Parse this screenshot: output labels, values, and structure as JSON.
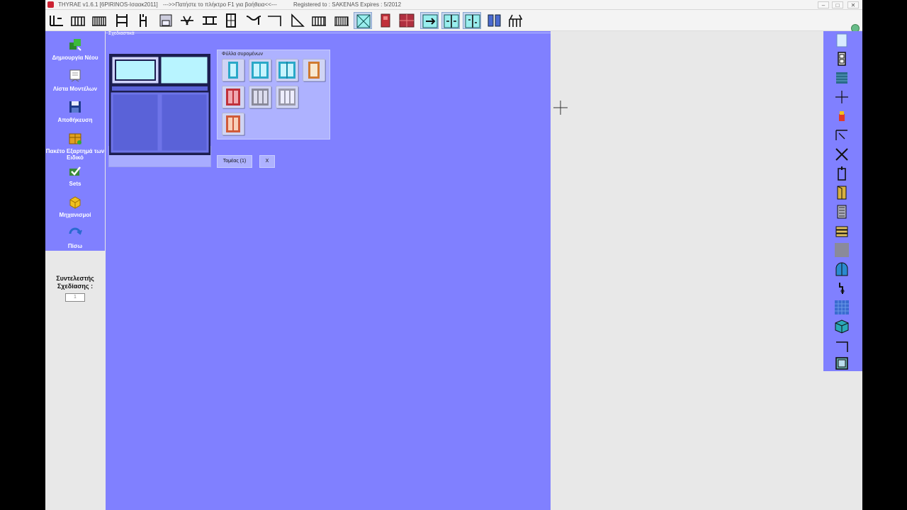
{
  "titlebar": {
    "app": "THYRAE v1.6.1 [6PIRINOS-Ισαακ2011]",
    "help": "--->>Πατήστε το πλήκτρο F1 για βοήθεια<<---",
    "registered": "Registered to : SAKENAS   Expires : 5/2012",
    "minimize": "–",
    "maximize": "□",
    "close": "✕"
  },
  "sidebar": {
    "items": [
      {
        "label": "Δημιουργία Νέου",
        "icon": "new-model-icon"
      },
      {
        "label": "Λίστα Μοντέλων",
        "icon": "model-list-icon"
      },
      {
        "label": "Αποθήκευση",
        "icon": "save-icon"
      },
      {
        "label": "Πακέτο Εξαρτημά των Ειδικό",
        "icon": "parts-package-icon"
      },
      {
        "label": "Sets",
        "icon": "sets-icon"
      },
      {
        "label": "Μηχανισμοί",
        "icon": "mechanisms-icon"
      },
      {
        "label": "Πίσω",
        "icon": "back-icon"
      }
    ],
    "coefficient_label": "Συντελεστής Σχεδίασης :",
    "coefficient_value": "1"
  },
  "canvas": {
    "title": "Σχεδιαστικά"
  },
  "sashes": {
    "title": "Φύλλα συρομένων"
  },
  "buttons": {
    "sections": "Τομέας (1)",
    "close": "X"
  },
  "colors": {
    "panel": "#8080ff",
    "workspace": "#e8e8e8",
    "glass": "#b8f4ff",
    "frame": "#1c1e50",
    "accent_red": "#c0303a"
  }
}
